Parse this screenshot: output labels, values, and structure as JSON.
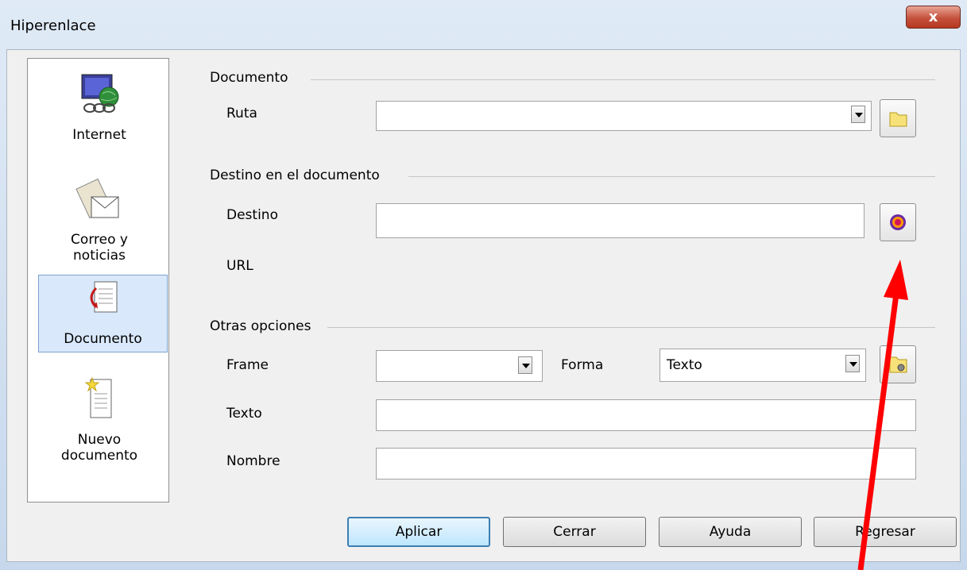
{
  "window": {
    "title": "Hiperenlace",
    "close_label": "x"
  },
  "sidebar": {
    "items": [
      {
        "label": "Internet"
      },
      {
        "label_line1": "Correo y",
        "label_line2": "noticias"
      },
      {
        "label": "Documento"
      },
      {
        "label_line1": "Nuevo",
        "label_line2": "documento"
      }
    ]
  },
  "documento": {
    "heading": "Documento",
    "ruta_label": "Ruta",
    "ruta_value": ""
  },
  "destino": {
    "heading": "Destino en el documento",
    "destino_label": "Destino",
    "destino_value": "",
    "url_label": "URL"
  },
  "opciones": {
    "heading": "Otras opciones",
    "frame_label": "Frame",
    "frame_value": "",
    "forma_label": "Forma",
    "forma_value": "Texto",
    "texto_label": "Texto",
    "texto_value": "",
    "nombre_label": "Nombre",
    "nombre_value": ""
  },
  "buttons": {
    "apply": "Aplicar",
    "close": "Cerrar",
    "help": "Ayuda",
    "back": "Regresar"
  },
  "colors": {
    "annotation_arrow": "#ff0000",
    "selection": "#d9e8fb"
  }
}
